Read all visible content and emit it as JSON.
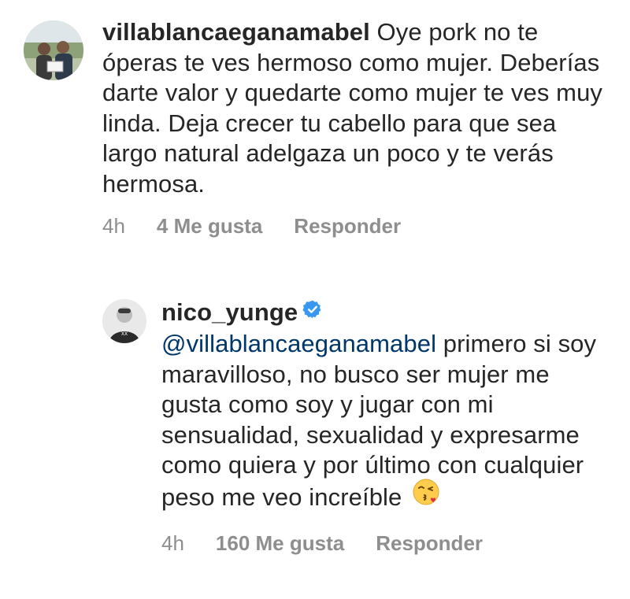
{
  "comments": [
    {
      "username": "villablancaeganamabel",
      "text": "Oye pork no te óperas te ves hermoso como mujer. Deberías darte valor y quedarte como mujer te ves muy linda. Deja crecer tu cabello para que sea largo natural adelgaza un poco y te verás hermosa.",
      "time": "4h",
      "likes": "4 Me gusta",
      "reply": "Responder"
    },
    {
      "username": "nico_yunge",
      "verified": true,
      "mention": "@villablancaeganamabel",
      "text": "primero si soy maravilloso, no busco ser mujer me gusta como soy y jugar con mi sensualidad, sexualidad y expresarme como quiera y por último con cualquier peso me veo increíble",
      "emoji": "kissing-heart-face-icon",
      "time": "4h",
      "likes": "160 Me gusta",
      "reply": "Responder"
    }
  ],
  "colors": {
    "text": "#262626",
    "meta": "#8e8e8e",
    "mention": "#00376b",
    "verified": "#3897f0"
  }
}
